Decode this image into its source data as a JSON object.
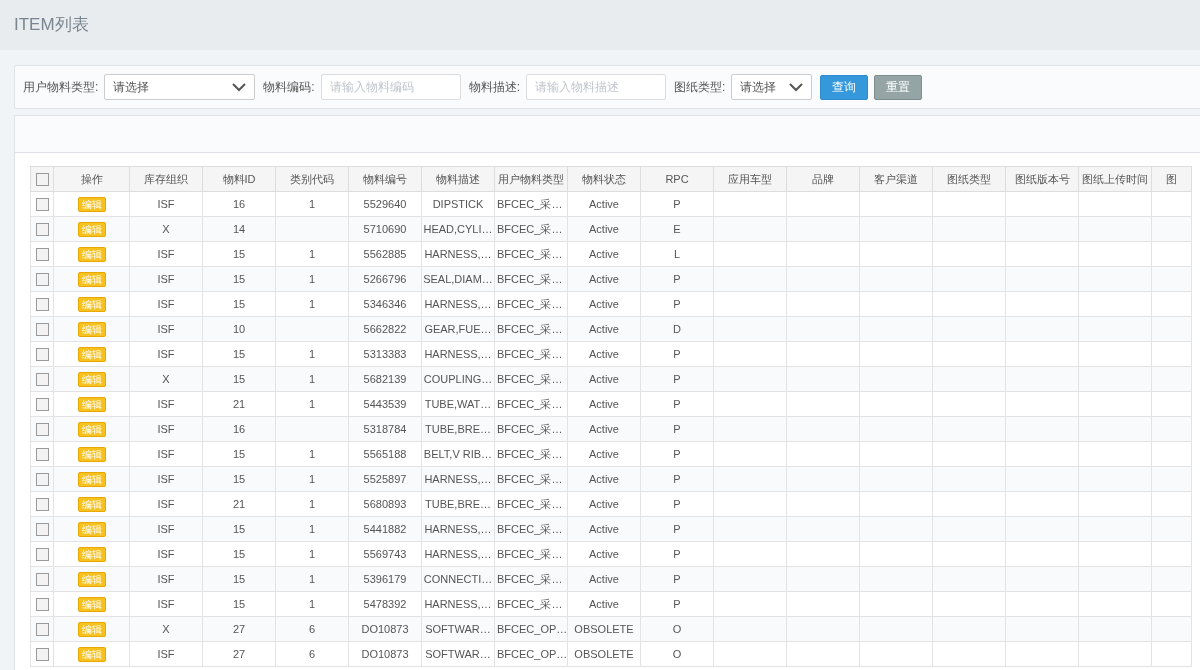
{
  "page_title": "ITEM列表",
  "filters": [
    {
      "kind": "select",
      "label": "用户物料类型:",
      "value": "请选择"
    },
    {
      "kind": "input",
      "label": "物料编码:",
      "placeholder": "请输入物料编码"
    },
    {
      "kind": "input",
      "label": "物料描述:",
      "placeholder": "请输入物料描述"
    },
    {
      "kind": "select",
      "label": "图纸类型:",
      "value": "请选择"
    }
  ],
  "buttons": [
    {
      "kind": "primary",
      "label": "查询"
    },
    {
      "kind": "secondary",
      "label": "重置"
    }
  ],
  "table": {
    "select_all": {
      "checked": false
    },
    "columns": [
      "操作",
      "库存组织",
      "物料ID",
      "类别代码",
      "物料编号",
      "物料描述",
      "用户物料类型",
      "物料状态",
      "RPC",
      "应用车型",
      "品牌",
      "客户渠道",
      "图纸类型",
      "图纸版本号",
      "图纸上传时间",
      "图"
    ],
    "rows": [
      {
        "checked": false,
        "action": "编辑",
        "org": "ISF",
        "id": "16",
        "category": "1",
        "code": "5529640",
        "desc": "DIPSTICK",
        "utype": "BFCEC_采…",
        "status": "Active",
        "rpc": "P"
      },
      {
        "checked": false,
        "action": "编辑",
        "org": "X",
        "id": "14",
        "category": "",
        "code": "5710690",
        "desc": "HEAD,CYLI…",
        "utype": "BFCEC_采…",
        "status": "Active",
        "rpc": "E"
      },
      {
        "checked": false,
        "action": "编辑",
        "org": "ISF",
        "id": "15",
        "category": "1",
        "code": "5562885",
        "desc": "HARNESS,…",
        "utype": "BFCEC_采…",
        "status": "Active",
        "rpc": "L"
      },
      {
        "checked": false,
        "action": "编辑",
        "org": "ISF",
        "id": "15",
        "category": "1",
        "code": "5266796",
        "desc": "SEAL,DIAM…",
        "utype": "BFCEC_采…",
        "status": "Active",
        "rpc": "P"
      },
      {
        "checked": false,
        "action": "编辑",
        "org": "ISF",
        "id": "15",
        "category": "1",
        "code": "5346346",
        "desc": "HARNESS,…",
        "utype": "BFCEC_采…",
        "status": "Active",
        "rpc": "P"
      },
      {
        "checked": false,
        "action": "编辑",
        "org": "ISF",
        "id": "10",
        "category": "",
        "code": "5662822",
        "desc": "GEAR,FUE…",
        "utype": "BFCEC_采…",
        "status": "Active",
        "rpc": "D"
      },
      {
        "checked": false,
        "action": "编辑",
        "org": "ISF",
        "id": "15",
        "category": "1",
        "code": "5313383",
        "desc": "HARNESS,…",
        "utype": "BFCEC_采…",
        "status": "Active",
        "rpc": "P"
      },
      {
        "checked": false,
        "action": "编辑",
        "org": "X",
        "id": "15",
        "category": "1",
        "code": "5682139",
        "desc": "COUPLING…",
        "utype": "BFCEC_采…",
        "status": "Active",
        "rpc": "P"
      },
      {
        "checked": false,
        "action": "编辑",
        "org": "ISF",
        "id": "21",
        "category": "1",
        "code": "5443539",
        "desc": "TUBE,WAT…",
        "utype": "BFCEC_采…",
        "status": "Active",
        "rpc": "P"
      },
      {
        "checked": false,
        "action": "编辑",
        "org": "ISF",
        "id": "16",
        "category": "",
        "code": "5318784",
        "desc": "TUBE,BRE…",
        "utype": "BFCEC_采…",
        "status": "Active",
        "rpc": "P"
      },
      {
        "checked": false,
        "action": "编辑",
        "org": "ISF",
        "id": "15",
        "category": "1",
        "code": "5565188",
        "desc": "BELT,V RIB…",
        "utype": "BFCEC_采…",
        "status": "Active",
        "rpc": "P"
      },
      {
        "checked": false,
        "action": "编辑",
        "org": "ISF",
        "id": "15",
        "category": "1",
        "code": "5525897",
        "desc": "HARNESS,…",
        "utype": "BFCEC_采…",
        "status": "Active",
        "rpc": "P"
      },
      {
        "checked": false,
        "action": "编辑",
        "org": "ISF",
        "id": "21",
        "category": "1",
        "code": "5680893",
        "desc": "TUBE,BRE…",
        "utype": "BFCEC_采…",
        "status": "Active",
        "rpc": "P"
      },
      {
        "checked": false,
        "action": "编辑",
        "org": "ISF",
        "id": "15",
        "category": "1",
        "code": "5441882",
        "desc": "HARNESS,…",
        "utype": "BFCEC_采…",
        "status": "Active",
        "rpc": "P"
      },
      {
        "checked": false,
        "action": "编辑",
        "org": "ISF",
        "id": "15",
        "category": "1",
        "code": "5569743",
        "desc": "HARNESS,…",
        "utype": "BFCEC_采…",
        "status": "Active",
        "rpc": "P"
      },
      {
        "checked": false,
        "action": "编辑",
        "org": "ISF",
        "id": "15",
        "category": "1",
        "code": "5396179",
        "desc": "CONNECTI…",
        "utype": "BFCEC_采…",
        "status": "Active",
        "rpc": "P"
      },
      {
        "checked": false,
        "action": "编辑",
        "org": "ISF",
        "id": "15",
        "category": "1",
        "code": "5478392",
        "desc": "HARNESS,…",
        "utype": "BFCEC_采…",
        "status": "Active",
        "rpc": "P"
      },
      {
        "checked": false,
        "action": "编辑",
        "org": "X",
        "id": "27",
        "category": "6",
        "code": "DO10873",
        "desc": "SOFTWAR…",
        "utype": "BFCEC_OP…",
        "status": "OBSOLETE",
        "rpc": "O"
      },
      {
        "checked": false,
        "action": "编辑",
        "org": "ISF",
        "id": "27",
        "category": "6",
        "code": "DO10873",
        "desc": "SOFTWAR…",
        "utype": "BFCEC_OP…",
        "status": "OBSOLETE",
        "rpc": "O"
      }
    ]
  }
}
